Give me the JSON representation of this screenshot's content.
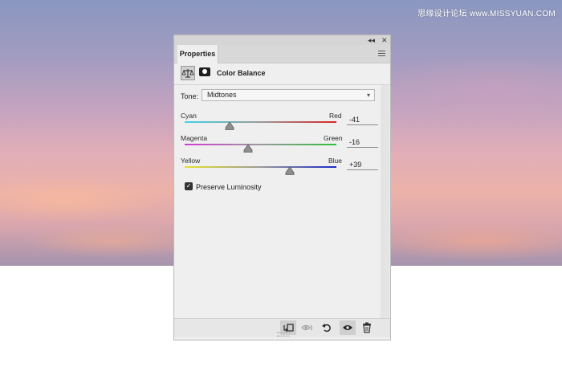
{
  "watermark": "思缘设计论坛 www.MISSYUAN.COM",
  "panel": {
    "collapse_label": "◂◂",
    "close_label": "✕",
    "tab_label": "Properties",
    "menu_icon": "panel-menu-icon"
  },
  "adjustment": {
    "title": "Color Balance",
    "icons": [
      "color-balance-icon",
      "layer-mask-icon"
    ]
  },
  "tone": {
    "label": "Tone:",
    "value": "Midtones"
  },
  "sliders": [
    {
      "left_label": "Cyan",
      "right_label": "Red",
      "value_text": "-41",
      "value": -41,
      "colors": [
        "#3fd4e6",
        "#d82424"
      ]
    },
    {
      "left_label": "Magenta",
      "right_label": "Green",
      "value_text": "-16",
      "value": -16,
      "colors": [
        "#d23ad6",
        "#2fbe39"
      ]
    },
    {
      "left_label": "Yellow",
      "right_label": "Blue",
      "value_text": "+39",
      "value": 39,
      "colors": [
        "#e6e22a",
        "#1c2ac8"
      ]
    }
  ],
  "preserve_luminosity": {
    "label": "Preserve Luminosity",
    "checked": true
  },
  "footer_buttons": [
    "clip-to-layer-icon",
    "view-previous-state-icon",
    "reset-icon",
    "visibility-eye-icon",
    "delete-trash-icon"
  ],
  "colors": {
    "panel_bg": "#efefef",
    "accent_gray": "#cfcfcf"
  }
}
